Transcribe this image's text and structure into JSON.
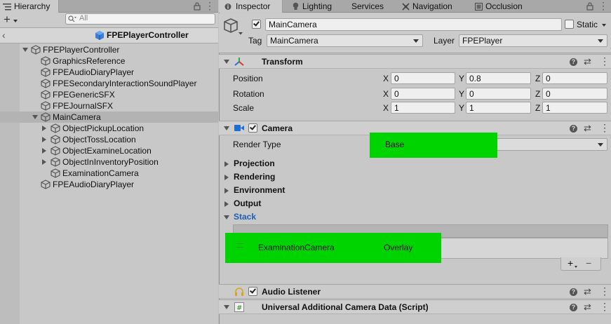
{
  "hierarchy": {
    "tab_label": "Hierarchy",
    "add_label": "+",
    "search_placeholder": "All",
    "prefab_title": "FPEPlayerController",
    "rows": [
      {
        "label": "FPEPlayerController",
        "level": 0,
        "arrow": "down",
        "selected": false
      },
      {
        "label": "GraphicsReference",
        "level": 1,
        "arrow": "none",
        "selected": false
      },
      {
        "label": "FPEAudioDiaryPlayer",
        "level": 1,
        "arrow": "none",
        "selected": false
      },
      {
        "label": "FPESecondaryInteractionSoundPlayer",
        "level": 1,
        "arrow": "none",
        "selected": false
      },
      {
        "label": "FPEGenericSFX",
        "level": 1,
        "arrow": "none",
        "selected": false
      },
      {
        "label": "FPEJournalSFX",
        "level": 1,
        "arrow": "none",
        "selected": false
      },
      {
        "label": "MainCamera",
        "level": 1,
        "arrow": "down",
        "selected": true
      },
      {
        "label": "ObjectPickupLocation",
        "level": 2,
        "arrow": "right",
        "selected": false
      },
      {
        "label": "ObjectTossLocation",
        "level": 2,
        "arrow": "right",
        "selected": false
      },
      {
        "label": "ObjectExamineLocation",
        "level": 2,
        "arrow": "right",
        "selected": false
      },
      {
        "label": "ObjectInInventoryPosition",
        "level": 2,
        "arrow": "right",
        "selected": false
      },
      {
        "label": "ExaminationCamera",
        "level": 2,
        "arrow": "none",
        "selected": false
      },
      {
        "label": "FPEAudioDiaryPlayer",
        "level": 1,
        "arrow": "none",
        "selected": false
      }
    ]
  },
  "inspector": {
    "tabs": [
      "Inspector",
      "Lighting",
      "Services",
      "Navigation",
      "Occlusion"
    ],
    "object_name": "MainCamera",
    "static_label": "Static",
    "tag_label": "Tag",
    "tag_value": "MainCamera",
    "layer_label": "Layer",
    "layer_value": "FPEPlayer",
    "transform": {
      "title": "Transform",
      "rows": [
        {
          "label": "Position",
          "x": "0",
          "y": "0.8",
          "z": "0"
        },
        {
          "label": "Rotation",
          "x": "0",
          "y": "0",
          "z": "0"
        },
        {
          "label": "Scale",
          "x": "1",
          "y": "1",
          "z": "1"
        }
      ],
      "axis_x": "X",
      "axis_y": "Y",
      "axis_z": "Z"
    },
    "camera": {
      "title": "Camera",
      "render_type_label": "Render Type",
      "render_type_value": "Base",
      "sections": [
        "Projection",
        "Rendering",
        "Environment",
        "Output"
      ],
      "stack_label": "Stack",
      "stack_item_name": "ExaminationCamera",
      "stack_item_type": "Overlay",
      "add_label": "+",
      "remove_label": "−"
    },
    "audio_listener": {
      "title": "Audio Listener"
    },
    "urp_data": {
      "title": "Universal Additional Camera Data (Script)"
    }
  },
  "colors": {
    "highlight": "#00d400",
    "camera_icon": "#1a6fd1",
    "stack_label": "#1d5fb5"
  }
}
